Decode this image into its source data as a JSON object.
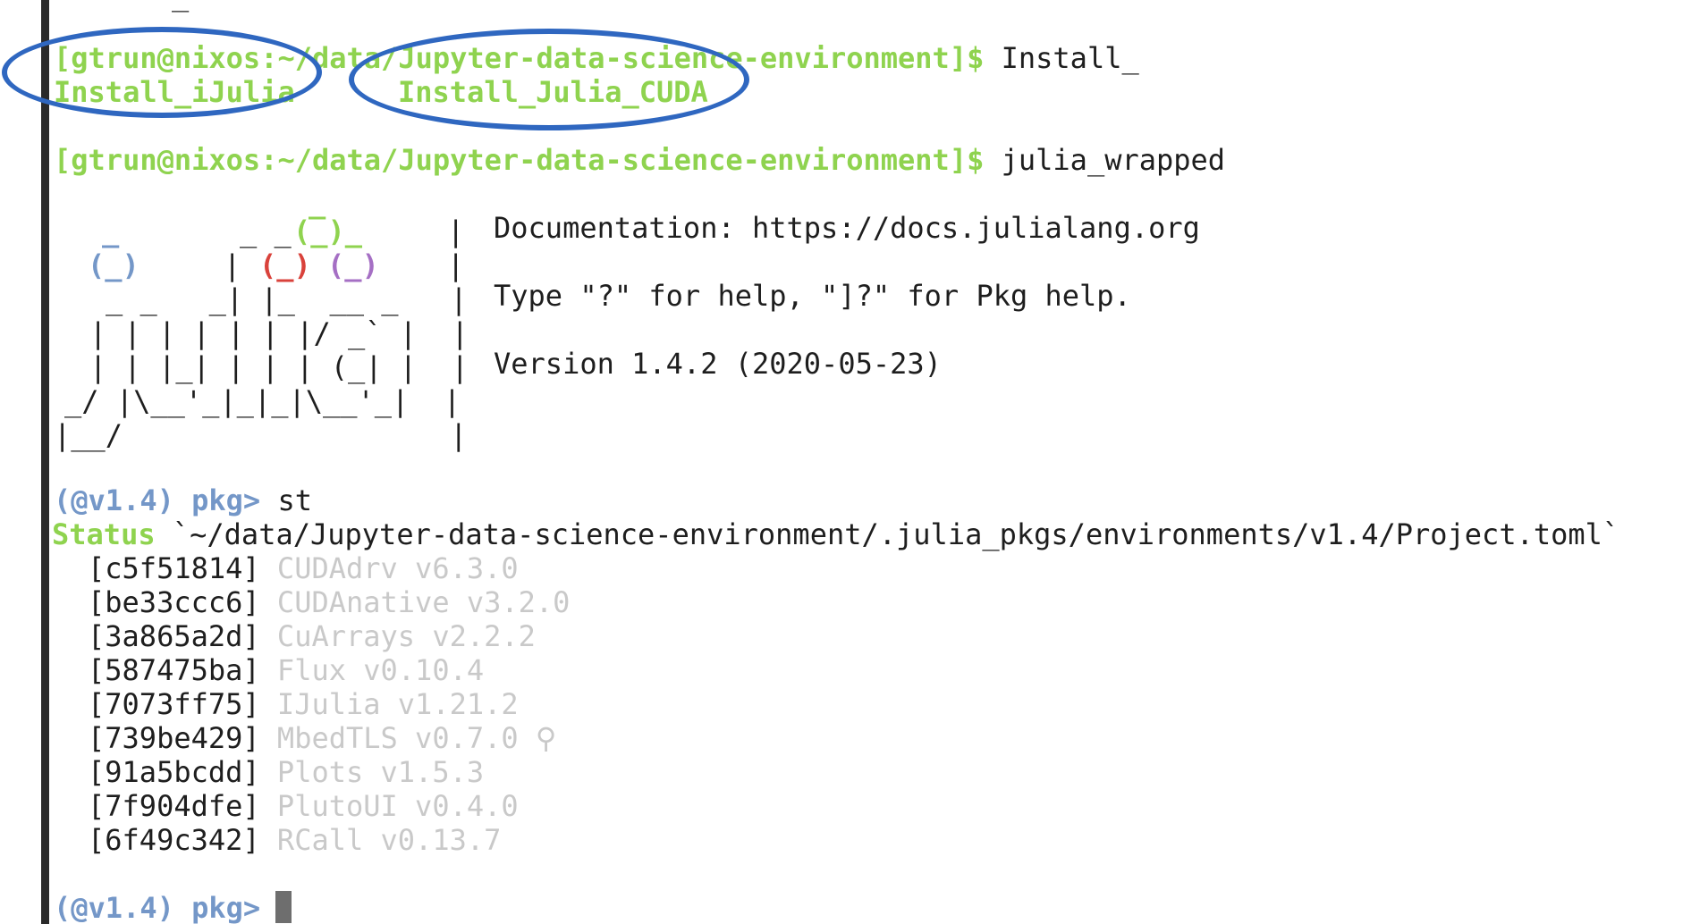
{
  "terminal": {
    "top_fragment": "_",
    "prompt": "[gtrun@nixos:~/data/Jupyter-data-science-environment]$",
    "command_1": " Install_",
    "completion_1": "Install_iJulia",
    "completion_2": "Install_Julia_CUDA",
    "command_2": " julia_wrapped"
  },
  "banner": {
    "art": {
      "l1_green": "_",
      "l2_blue": "_",
      "l2_plain": "_ _",
      "l2_green": "(_)_",
      "l2_bar": "|",
      "l3_blue": "(_)",
      "l3_pipe": "|",
      "l3_red": "(_)",
      "l3_purple": "(_)",
      "l3_bar": "|",
      "l4": "_ _   _| |_  __ _   |",
      "l5": "| | | | | | |/ _` |  |",
      "l6": "| | |_| | | | (_| |  |",
      "l7": "_/ |\\__'_|_|_|\\__'_|  |",
      "l8": "|__/                   |"
    },
    "documentation": "Documentation: https://docs.julialang.org",
    "help": "Type \"?\" for help, \"]?\" for Pkg help.",
    "version": "Version 1.4.2 (2020-05-23)"
  },
  "pkg": {
    "prompt": "(@v1.4) pkg>",
    "command": " st",
    "status_label": "Status",
    "status_path": " `~/data/Jupyter-data-science-environment/.julia_pkgs/environments/v1.4/Project.toml`",
    "packages": [
      {
        "uuid": "[c5f51814]",
        "name": "CUDAdrv v6.3.0"
      },
      {
        "uuid": "[be33ccc6]",
        "name": "CUDAnative v3.2.0"
      },
      {
        "uuid": "[3a865a2d]",
        "name": "CuArrays v2.2.2"
      },
      {
        "uuid": "[587475ba]",
        "name": "Flux v0.10.4"
      },
      {
        "uuid": "[7073ff75]",
        "name": "IJulia v1.21.2"
      },
      {
        "uuid": "[739be429]",
        "name": "MbedTLS v0.7.0 ⚲"
      },
      {
        "uuid": "[91a5bcdd]",
        "name": "Plots v1.5.3"
      },
      {
        "uuid": "[7f904dfe]",
        "name": "PlutoUI v0.4.0"
      },
      {
        "uuid": "[6f49c342]",
        "name": "RCall v0.13.7"
      }
    ],
    "final_prompt": "(@v1.4) pkg>"
  },
  "colors": {
    "prompt_green": "#8fd34f",
    "pkg_blue": "#7497c8",
    "annotation_blue": "#2f67c0",
    "dim_package": "#c9c9c9"
  }
}
